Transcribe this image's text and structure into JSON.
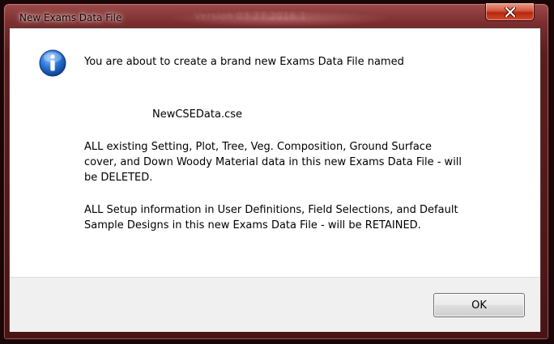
{
  "window": {
    "title": "New Exams Data File",
    "ghost_title": "Version 03.27.2016.1"
  },
  "dialog": {
    "icon": "information-icon",
    "line1": "You are about to create a brand new Exams Data File named",
    "file_name": "NewCSEData.cse",
    "paragraph2": [
      "ALL existing Setting, Plot, Tree, Veg. Composition, Ground Surface",
      "cover, and Down Woody Material data in this new Exams Data File - will",
      "be DELETED."
    ],
    "paragraph3": [
      "ALL Setup information in User Definitions, Field Selections, and Default",
      "Sample Designs in this new Exams Data File - will be RETAINED."
    ],
    "ok_label": "OK"
  },
  "colors": {
    "frame": "#7d2f2f",
    "close_button": "#c8371c",
    "info_icon": "#1f5fbf"
  }
}
